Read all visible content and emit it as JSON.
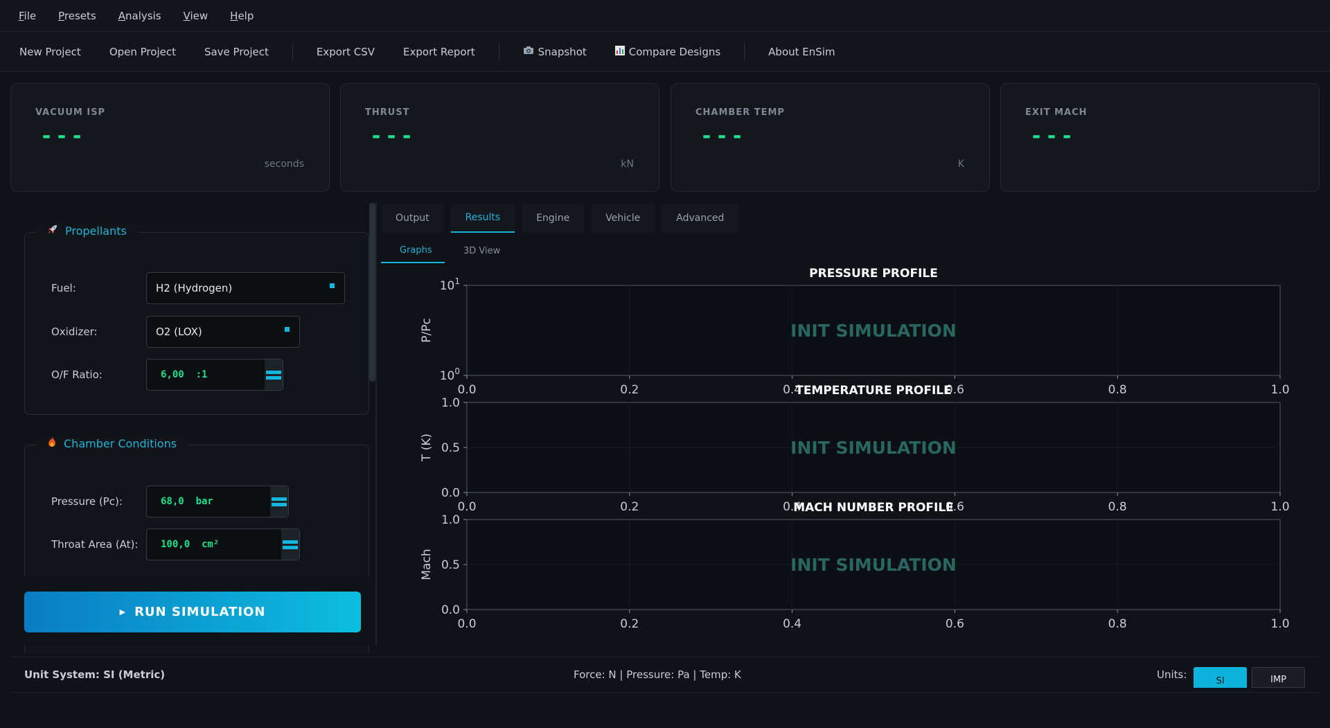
{
  "menu": [
    {
      "label": "File",
      "u": "F",
      "rest": "ile"
    },
    {
      "label": "Presets",
      "u": "P",
      "rest": "resets"
    },
    {
      "label": "Analysis",
      "u": "A",
      "rest": "nalysis"
    },
    {
      "label": "View",
      "u": "V",
      "rest": "iew"
    },
    {
      "label": "Help",
      "u": "H",
      "rest": "elp"
    }
  ],
  "toolbar": {
    "new_project": "New Project",
    "open_project": "Open Project",
    "save_project": "Save Project",
    "export_csv": "Export CSV",
    "export_report": "Export Report",
    "snapshot": "Snapshot",
    "compare_designs": "Compare Designs",
    "about": "About EnSim"
  },
  "cards": [
    {
      "label": "VACUUM ISP",
      "value": "---",
      "unit": "seconds"
    },
    {
      "label": "THRUST",
      "value": "---",
      "unit": "kN"
    },
    {
      "label": "CHAMBER TEMP",
      "value": "---",
      "unit": "K"
    },
    {
      "label": "EXIT MACH",
      "value": "---",
      "unit": ""
    }
  ],
  "propellants": {
    "title": "Propellants",
    "fuel_label": "Fuel:",
    "fuel_value": "H2 (Hydrogen)",
    "oxidizer_label": "Oxidizer:",
    "oxidizer_value": "O2 (LOX)",
    "of_label": "O/F Ratio:",
    "of_value": "6,00  :1"
  },
  "chamber": {
    "title": "Chamber Conditions",
    "pressure_label": "Pressure (Pc):",
    "pressure_value": "68,0  bar",
    "throat_label": "Throat Area (At):",
    "throat_value": "100,0  cm²"
  },
  "run_button": "RUN SIMULATION",
  "tabs": [
    "Output",
    "Results",
    "Engine",
    "Vehicle",
    "Advanced"
  ],
  "active_tab": "Results",
  "subtabs": [
    "Graphs",
    "3D View"
  ],
  "active_subtab": "Graphs",
  "chart_data": [
    {
      "type": "line",
      "title": "PRESSURE PROFILE",
      "ylabel": "P/Pc",
      "xlabel": "",
      "xlim": [
        0.0,
        1.0
      ],
      "ylim": [
        1,
        10
      ],
      "yscale": "log",
      "xticks": [
        "0.0",
        "0.2",
        "0.4",
        "0.6",
        "0.8",
        "1.0"
      ],
      "yticks": [
        "10^0",
        "10^1"
      ],
      "series": [],
      "annotation": "INIT SIMULATION",
      "grid": true
    },
    {
      "type": "line",
      "title": "TEMPERATURE PROFILE",
      "ylabel": "T (K)",
      "xlabel": "",
      "xlim": [
        0.0,
        1.0
      ],
      "ylim": [
        0.0,
        1.0
      ],
      "xticks": [
        "0.0",
        "0.2",
        "0.4",
        "0.6",
        "0.8",
        "1.0"
      ],
      "yticks": [
        "0.0",
        "0.5",
        "1.0"
      ],
      "series": [],
      "annotation": "INIT SIMULATION",
      "grid": true
    },
    {
      "type": "line",
      "title": "MACH NUMBER PROFILE",
      "ylabel": "Mach",
      "xlabel": "",
      "xlim": [
        0.0,
        1.0
      ],
      "ylim": [
        0.0,
        1.0
      ],
      "xticks": [
        "0.0",
        "0.2",
        "0.4",
        "0.6",
        "0.8",
        "1.0"
      ],
      "yticks": [
        "0.0",
        "0.5",
        "1.0"
      ],
      "series": [],
      "annotation": "INIT SIMULATION",
      "grid": true
    }
  ],
  "status": {
    "unit_system": "Unit System: SI (Metric)",
    "units_info": "Force: N | Pressure: Pa | Temp: K",
    "units_label": "Units:",
    "si": "SI",
    "imp": "IMP"
  },
  "colors": {
    "accent": "#12b7de",
    "value_green": "#1fe08c",
    "annotation": "#2a6660"
  }
}
